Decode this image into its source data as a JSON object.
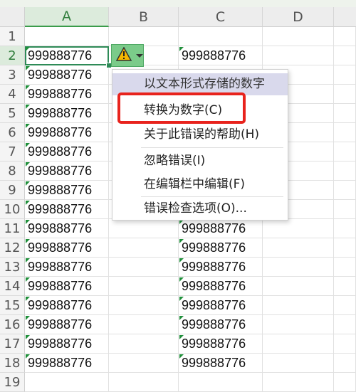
{
  "columns": [
    "A",
    "B",
    "C",
    "D"
  ],
  "rows": [
    "1",
    "2",
    "3",
    "4",
    "5",
    "6",
    "7",
    "8",
    "9",
    "10",
    "11",
    "12",
    "13",
    "14",
    "15",
    "16",
    "17",
    "18",
    "19"
  ],
  "cell_value": "999888776",
  "column_a_values": [
    "",
    "999888776",
    "999888776",
    "999888776",
    "999888776",
    "999888776",
    "999888776",
    "999888776",
    "999888776",
    "999888776",
    "999888776",
    "999888776",
    "999888776",
    "999888776",
    "999888776",
    "999888776",
    "999888776",
    "999888776",
    ""
  ],
  "column_c_values": [
    "",
    "999888776",
    "",
    "",
    "",
    "",
    "",
    "",
    "",
    "",
    "999888776",
    "999888776",
    "999888776",
    "999888776",
    "999888776",
    "999888776",
    "999888776",
    "999888776",
    ""
  ],
  "error_menu": {
    "header": "以文本形式存储的数字",
    "items": [
      "转换为数字(C)",
      "关于此错误的帮助(H)",
      "忽略错误(I)",
      "在编辑栏中编辑(F)",
      "错误检查选项(O)..."
    ]
  },
  "colors": {
    "accent": "#2e8b57",
    "highlight": "#e8231d",
    "warning": "#f5b800"
  }
}
